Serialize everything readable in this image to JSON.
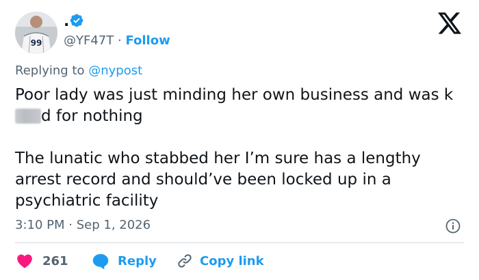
{
  "user": {
    "display_name": ".",
    "handle": "@YF47T",
    "separator": "·",
    "follow_label": "Follow",
    "verified": true,
    "jersey_number": "99"
  },
  "reply_context": {
    "prefix": "Replying to",
    "mention": "@nypost"
  },
  "tweet": {
    "paragraph1_before": "Poor lady was just minding her own business and was k",
    "paragraph1_after": "d for nothing",
    "paragraph2": "The lunatic who stabbed her I’m sure has a lengthy arrest record and should’ve been locked up in a psychiatric facility"
  },
  "meta": {
    "time": "3:10 PM",
    "separator": "·",
    "date": "Sep 1, 2026"
  },
  "actions": {
    "likes": "261",
    "reply_label": "Reply",
    "copy_label": "Copy link"
  },
  "colors": {
    "accent": "#1d9bf0",
    "like": "#f91880",
    "text": "#0f1419",
    "secondary": "#536471",
    "divider": "#cfd9de"
  },
  "icons": [
    "verified-badge-icon",
    "x-logo-icon",
    "info-icon",
    "heart-icon",
    "reply-bubble-icon",
    "link-icon"
  ]
}
